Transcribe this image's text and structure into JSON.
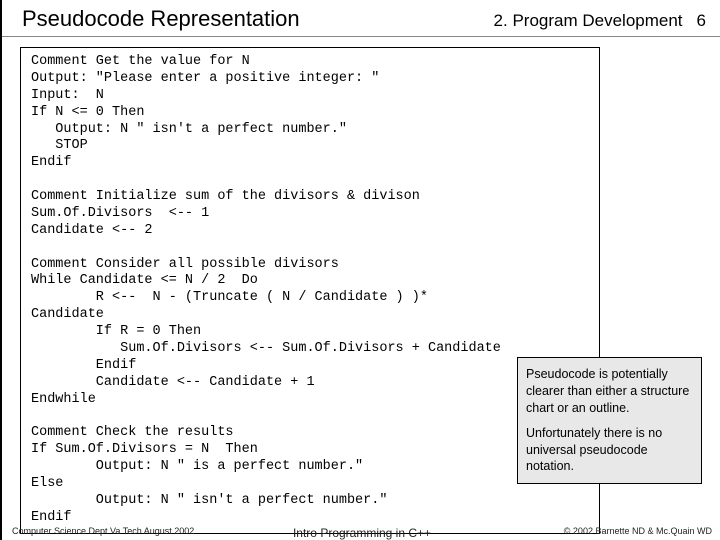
{
  "header": {
    "title_left": "Pseudocode Representation",
    "title_right": "2. Program Development",
    "page_number": "6"
  },
  "code": "Comment Get the value for N\nOutput: \"Please enter a positive integer: \"\nInput:  N\nIf N <= 0 Then\n   Output: N \" isn't a perfect number.\"\n   STOP\nEndif\n\nComment Initialize sum of the divisors & divison\nSum.Of.Divisors  <-- 1\nCandidate <-- 2\n\nComment Consider all possible divisors\nWhile Candidate <= N / 2  Do\n        R <--  N - (Truncate ( N / Candidate ) )*\nCandidate\n        If R = 0 Then\n           Sum.Of.Divisors <-- Sum.Of.Divisors + Candidate\n        Endif\n        Candidate <-- Candidate + 1\nEndwhile\n\nComment Check the results\nIf Sum.Of.Divisors = N  Then\n        Output: N \" is a perfect number.\"\nElse\n        Output: N \" isn't a perfect number.\"\nEndif",
  "note": {
    "p1": "Pseudocode is potentially clearer than either a structure chart or an outline.",
    "p2": "Unfortunately there is no universal pseudocode notation."
  },
  "footer": {
    "left": "Computer Science Dept Va Tech August 2002",
    "center": "Intro Programming in C++",
    "right": "© 2002  Barnette ND & Mc.Quain WD"
  }
}
